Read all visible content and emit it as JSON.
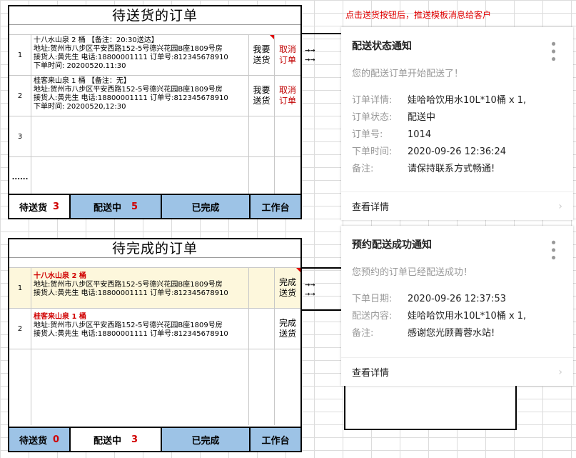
{
  "pending_panel": {
    "title": "待送货的订单",
    "orders": [
      {
        "index": "1",
        "line1": "十八水山泉 2 桶 【备注：20:30送达】",
        "line2": "地址:贺州市八步区平安西路152-5号德兴花园B座1809号房",
        "line3": "接货人:黄先生   电话:18800001111 订单号:812345678910",
        "line4": "下单时间: 20200520.11:30",
        "deliver": "我要送货",
        "cancel": "取消订单"
      },
      {
        "index": "2",
        "line1": "桂客来山泉 1 桶          【备注：无】",
        "line2": "地址:贺州市八步区平安西路152-5号德兴花园B座1809号房",
        "line3": "接货人:黄先生   电话:18800001111 订单号:812345678910",
        "line4": "下单时间: 20200520,12:30",
        "deliver": "我要送货",
        "cancel": "取消订单"
      }
    ],
    "row3_index": "3",
    "dots": "......",
    "tabs": [
      {
        "label": "待送货",
        "count": "3"
      },
      {
        "label": "配送中",
        "count": "5"
      },
      {
        "label": "已完成",
        "count": ""
      },
      {
        "label": "工作台",
        "count": ""
      }
    ],
    "arrows": "→→"
  },
  "complete_panel": {
    "title": "待完成的订单",
    "orders": [
      {
        "index": "1",
        "line1": "十八水山泉 2 桶",
        "line2": "地址:贺州市八步区平安西路152-5号德兴花园B座1809号房",
        "line3": "接货人:黄先生   电话:18800001111 订单号:812345678910",
        "action": "完成送货"
      },
      {
        "index": "2",
        "line1": "桂客来山泉 1 桶",
        "line2": "地址:贺州市八步区平安西路152-5号德兴花园B座1809号房",
        "line3": "接货人:黄先生   电话:18800001111 订单号:812345678910",
        "action": "完成送货"
      }
    ],
    "tabs": [
      {
        "label": "待送货",
        "count": "0"
      },
      {
        "label": "配送中",
        "count": "3"
      },
      {
        "label": "已完成",
        "count": ""
      },
      {
        "label": "工作台",
        "count": ""
      }
    ],
    "arrows": "→→"
  },
  "note": "点击送货按钮后，推送模板消息给客户",
  "card1": {
    "title": "配送状态通知",
    "subtitle": "您的配送订单开始配送了！",
    "fields": [
      {
        "k": "订单详情:",
        "v": "娃哈哈饮用水10L*10桶 x 1,"
      },
      {
        "k": "订单状态:",
        "v": "配送中"
      },
      {
        "k": "订单号:",
        "v": "1014"
      },
      {
        "k": "下单时间:",
        "v": "2020-09-26 12:36:24"
      },
      {
        "k": "备注:",
        "v": "请保持联系方式畅通!"
      }
    ],
    "footer": "查看详情"
  },
  "card2": {
    "title": "预约配送成功通知",
    "subtitle": "您预约的订单已经配送成功！",
    "fields": [
      {
        "k": "下单日期:",
        "v": "2020-09-26 12:37:53"
      },
      {
        "k": "配送内容:",
        "v": "娃哈哈饮用水10L*10桶 x 1,"
      },
      {
        "k": "备注:",
        "v": "感谢您光顾菁蓉水站!"
      }
    ],
    "footer": "查看详情"
  },
  "icons": {
    "menu": "more-vertical-icon",
    "chevron": "chevron-right-icon"
  }
}
